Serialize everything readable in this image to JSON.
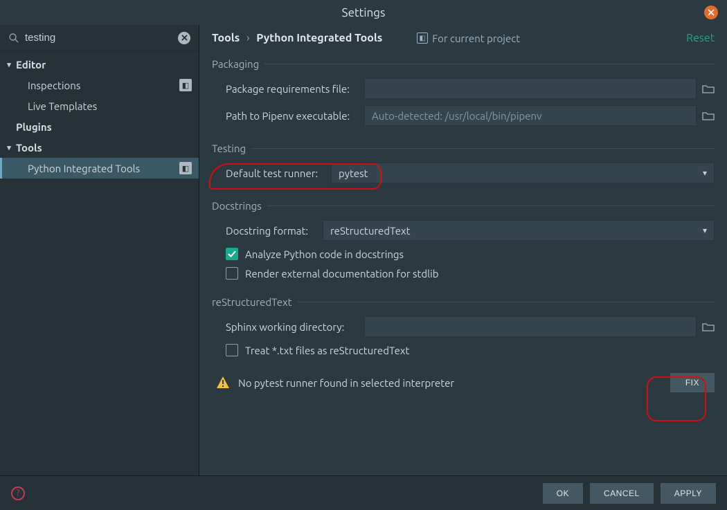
{
  "title": "Settings",
  "search": {
    "value": "testing"
  },
  "sidebar": {
    "groups": [
      {
        "label": "Editor",
        "expanded": true,
        "children": [
          {
            "label": "Inspections",
            "locator": true
          },
          {
            "label": "Live Templates"
          }
        ]
      },
      {
        "label": "Plugins",
        "children": []
      },
      {
        "label": "Tools",
        "expanded": true,
        "children": [
          {
            "label": "Python Integrated Tools",
            "locator": true,
            "selected": true
          }
        ]
      }
    ]
  },
  "breadcrumb": {
    "root": "Tools",
    "page": "Python Integrated Tools"
  },
  "project_scope": "For current project",
  "reset": "Reset",
  "sections": {
    "packaging": {
      "title": "Packaging",
      "req_label": "Package requirements file:",
      "req_value": "",
      "pipenv_label": "Path to Pipenv executable:",
      "pipenv_placeholder": "Auto-detected: /usr/local/bin/pipenv"
    },
    "testing": {
      "title": "Testing",
      "runner_label": "Default test runner:",
      "runner_value": "pytest"
    },
    "docstrings": {
      "title": "Docstrings",
      "format_label": "Docstring format:",
      "format_value": "reStructuredText",
      "analyze_label": "Analyze Python code in docstrings",
      "analyze_checked": true,
      "render_label": "Render external documentation for stdlib",
      "render_checked": false
    },
    "rst": {
      "title": "reStructuredText",
      "sphinx_label": "Sphinx working directory:",
      "sphinx_value": "",
      "txt_label": "Treat *.txt files as reStructuredText",
      "txt_checked": false
    }
  },
  "warning": {
    "text": "No pytest runner found in selected interpreter",
    "button": "FIX"
  },
  "footer": {
    "ok": "OK",
    "cancel": "CANCEL",
    "apply": "APPLY"
  }
}
